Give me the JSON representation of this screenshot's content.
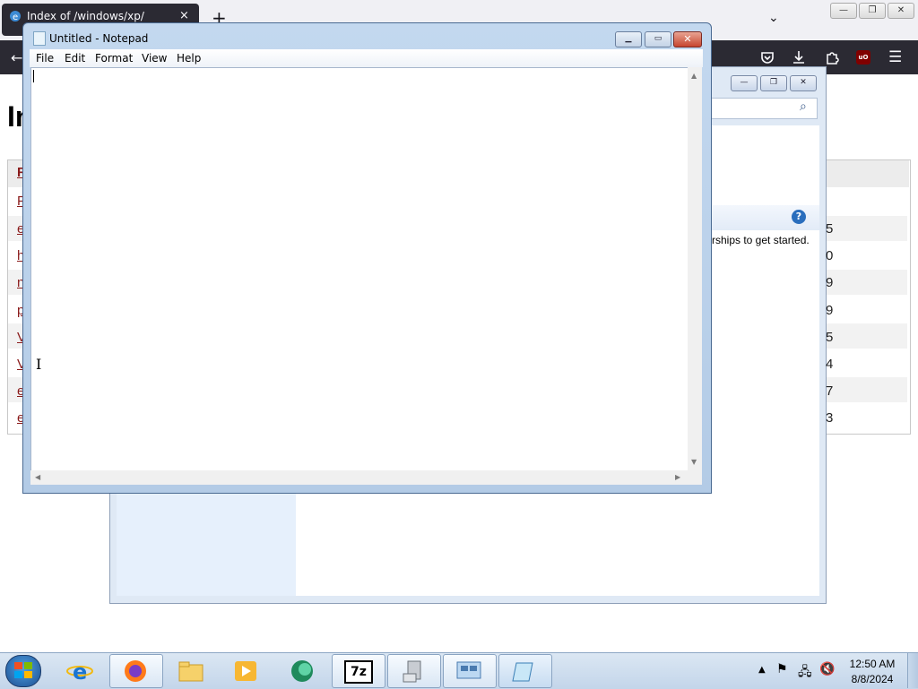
{
  "browser": {
    "tab_title": "Index of /windows/xp/",
    "tab_close": "×",
    "new_tab": "+",
    "tab_list": "⌄",
    "page_heading_partial": "In",
    "listing_link_chars": [
      "R",
      "P",
      "e",
      "h",
      "n",
      "p",
      "V",
      "V",
      "e",
      "e"
    ],
    "listing_sizes_partial": [
      "5",
      "0",
      "9",
      "9",
      "5",
      "4",
      "7",
      "3"
    ],
    "window_controls": {
      "minimize": "—",
      "restore": "❐",
      "close": "✕"
    },
    "toolbar_icons": [
      "pocket-icon",
      "download-icon",
      "extensions-icon",
      "ublock-icon",
      "menu-icon"
    ],
    "ublock_label": "uO"
  },
  "background_window": {
    "partial_text": "rships to get started.",
    "help_label": "?",
    "search_icon": "⌕",
    "controls": {
      "minimize": "—",
      "restore": "❐",
      "close": "✕"
    }
  },
  "notepad": {
    "title": "Untitled - Notepad",
    "menu": [
      "File",
      "Edit",
      "Format",
      "View",
      "Help"
    ],
    "content": "",
    "controls": {
      "minimize": "▁",
      "maximize": "▭",
      "close": "✕"
    }
  },
  "taskbar": {
    "apps": [
      "internet-explorer",
      "firefox",
      "windows-explorer",
      "media-player",
      "app-green",
      "7-zip",
      "computer",
      "network-control-panel",
      "notepad"
    ],
    "seven_zip_label": "7z",
    "time": "12:50 AM",
    "date": "8/8/2024"
  },
  "colors": {
    "firefox_dark": "#2b2a33",
    "link_red": "#8b1c1c",
    "win7_title": "#b3cbe6",
    "taskbar": "#c3d5ea"
  }
}
